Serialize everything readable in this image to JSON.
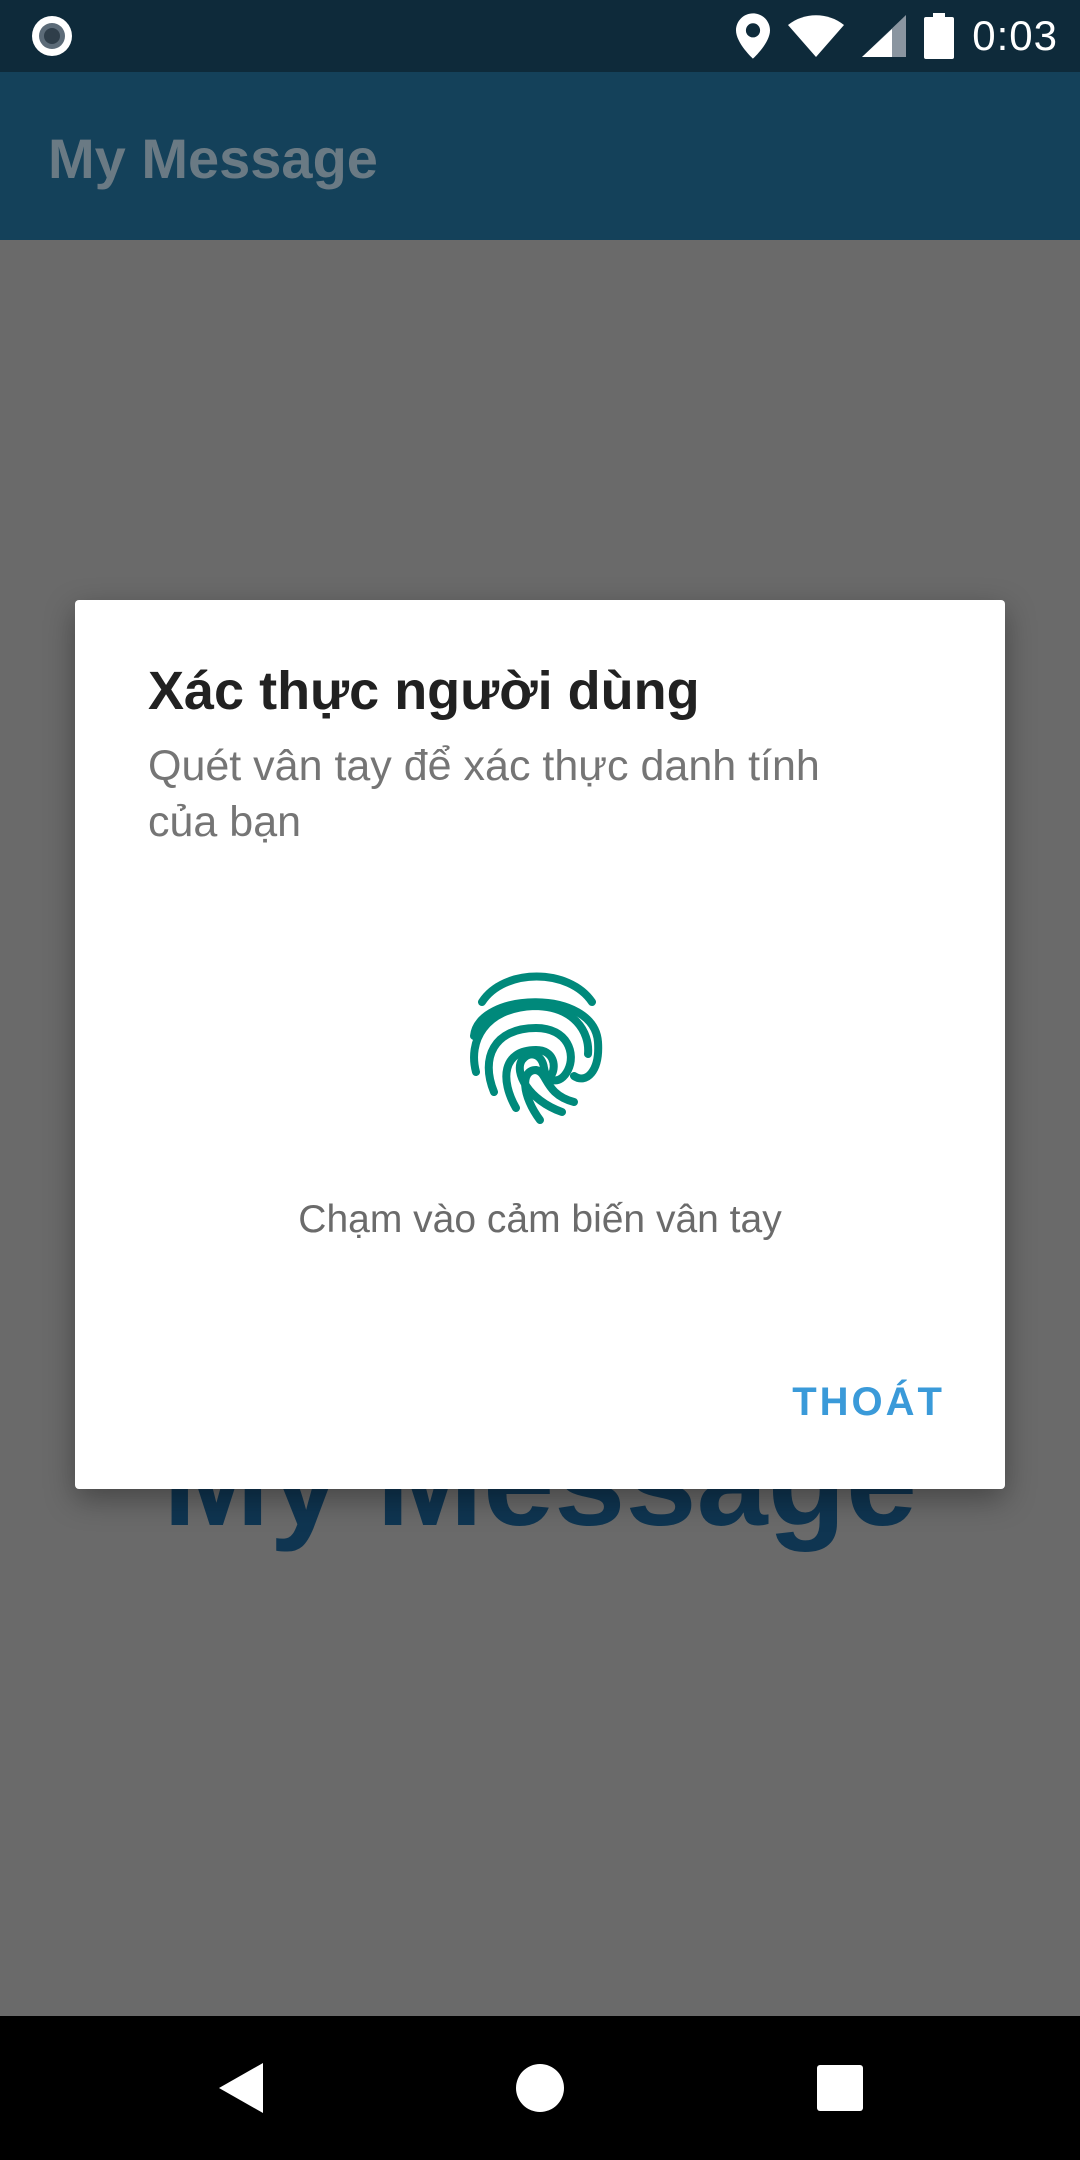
{
  "status_bar": {
    "time": "0:03",
    "icons": [
      "record-icon",
      "location-icon",
      "wifi-icon",
      "signal-icon",
      "battery-icon"
    ]
  },
  "app_bar": {
    "title": "My Message"
  },
  "background": {
    "title": "My Message"
  },
  "dialog": {
    "title": "Xác thực người dùng",
    "subtitle": "Quét vân tay để xác thực danh tính của bạn",
    "hint": "Chạm vào cảm biến vân tay",
    "exit_label": "THOÁT",
    "icon": "fingerprint-icon"
  },
  "nav_bar": {
    "icons": [
      "back-icon",
      "home-icon",
      "recents-icon"
    ]
  },
  "colors": {
    "accent": "#3a9ad9",
    "fingerprint": "#00897b",
    "app_bar": "#14415a"
  }
}
